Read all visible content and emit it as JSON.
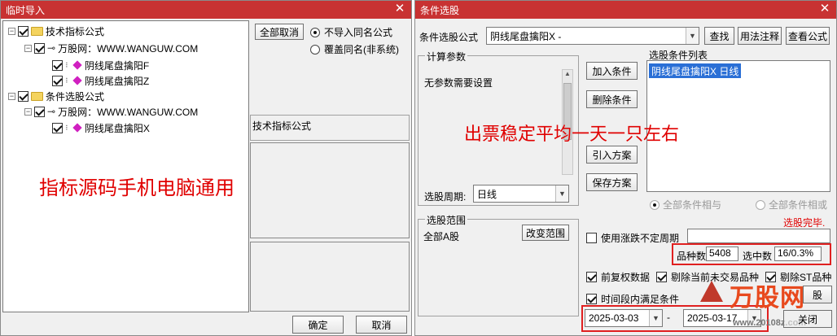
{
  "left_window": {
    "title": "临时导入",
    "tree": {
      "group1": "技术指标公式",
      "site1": "万股网：WWW.WANGUW.COM",
      "item1": "阴线尾盘擒阳F",
      "item2": "阴线尾盘擒阳Z",
      "group2": "条件选股公式",
      "site2": "万股网：WWW.WANGUW.COM",
      "item3": "阴线尾盘擒阳X"
    },
    "deselect_all": "全部取消",
    "radio_no_import": "不导入同名公式",
    "radio_overwrite": "覆盖同名(非系统)",
    "preview_label": "技术指标公式",
    "overlay_text": "指标源码手机电脑通用",
    "ok": "确定",
    "cancel": "取消"
  },
  "right_window": {
    "title": "条件选股",
    "formula_label": "条件选股公式",
    "formula_value": "阴线尾盘擒阳X  -",
    "find": "查找",
    "usage": "用法注释",
    "view": "查看公式",
    "params_legend": "计算参数",
    "no_params": "无参数需要设置",
    "period_label": "选股周期:",
    "period_value": "日线",
    "add_condition": "加入条件",
    "delete_condition": "删除条件",
    "import_plan": "引入方案",
    "save_plan": "保存方案",
    "list_label": "选股条件列表",
    "list_item": "阴线尾盘擒阳X  日线",
    "all_and": "全部条件相与",
    "all_or": "全部条件相或",
    "done": "选股完毕.",
    "overlay_text": "出票稳定平均一天一只左右",
    "range_legend": "选股范围",
    "range_value": "全部A股",
    "change_range": "改变范围",
    "use_variable_period": "使用涨跌不定周期",
    "count_label": "品种数",
    "count_value": "5408",
    "selected_label": "选中数",
    "selected_value": "16/0.3%",
    "forward_adjust": "前复权数据",
    "exclude_untraded": "剔除当前未交易品种",
    "exclude_st": "剔除ST品种",
    "timeframe": "时间段内满足条件",
    "date_start": "2025-03-03",
    "date_end": "2025-03-17",
    "close": "关闭",
    "badge_text": "万股网",
    "badge_url": "www.20108z.com",
    "watermark": "万股网"
  }
}
